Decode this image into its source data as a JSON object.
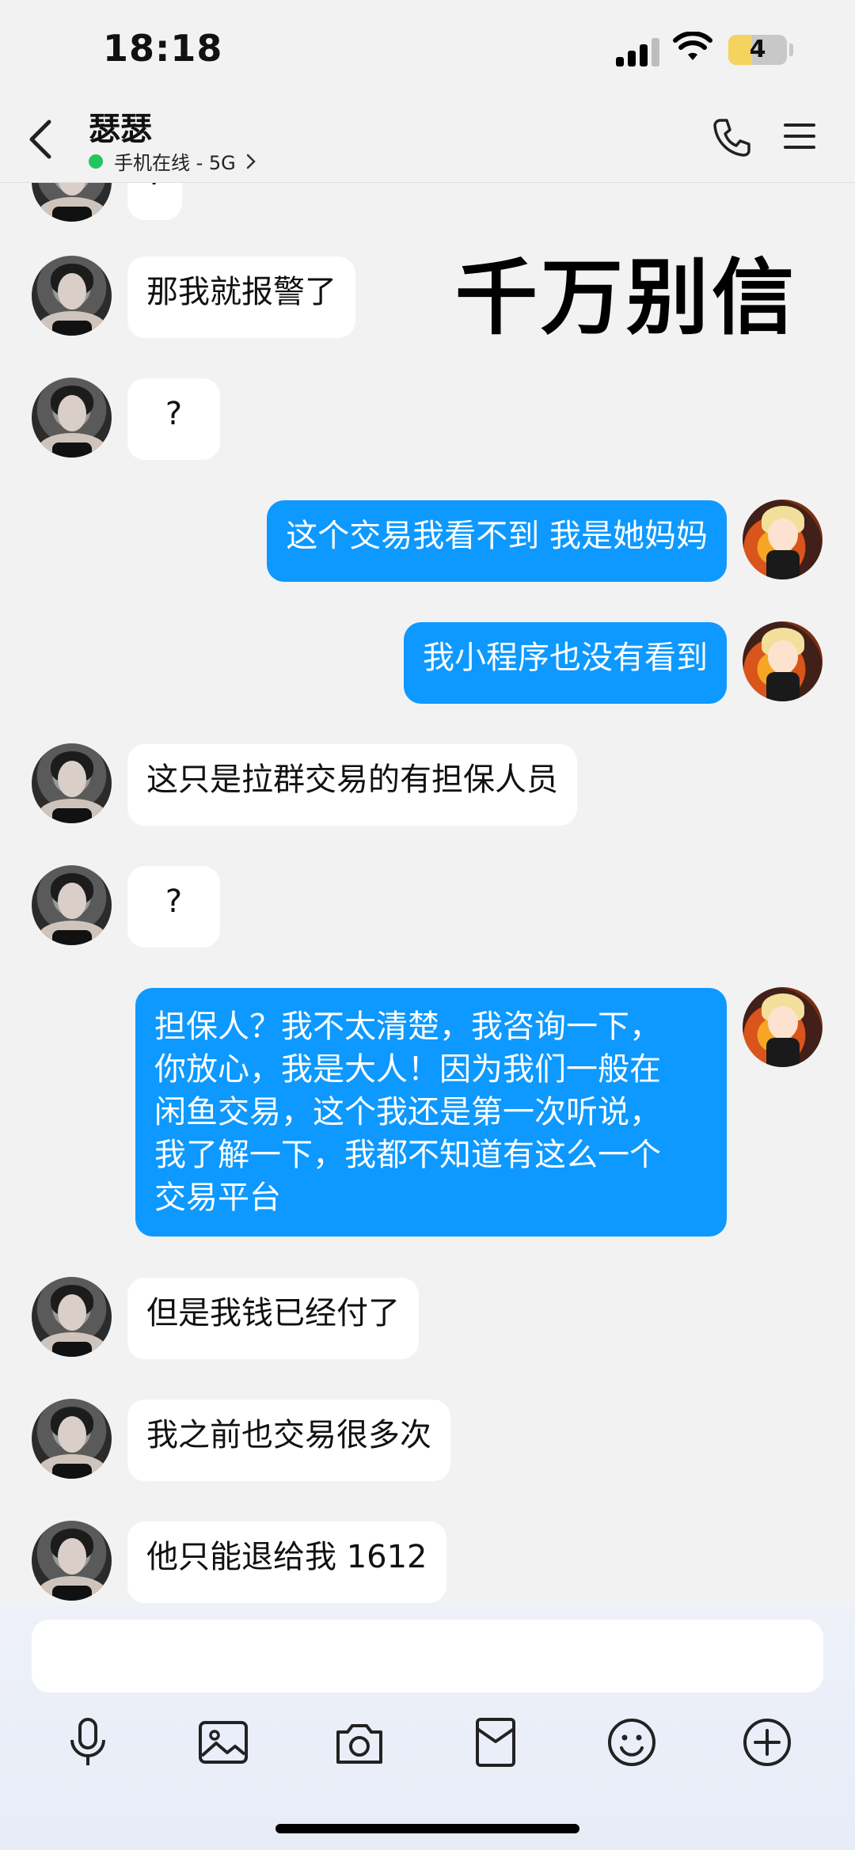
{
  "status_bar": {
    "time": "18:18",
    "battery": "4",
    "battery_level": 0.4
  },
  "header": {
    "contact_name": "瑟瑟",
    "online_status": "手机在线 - 5G"
  },
  "overlay_text": "千万别信",
  "messages": [
    {
      "from": "other",
      "text": "?"
    },
    {
      "from": "other",
      "text": "那我就报警了"
    },
    {
      "from": "other",
      "text": "?"
    },
    {
      "from": "me",
      "text": "这个交易我看不到 我是她妈妈"
    },
    {
      "from": "me",
      "text": "我小程序也没有看到"
    },
    {
      "from": "other",
      "text": "这只是拉群交易的有担保人员"
    },
    {
      "from": "other",
      "text": "?"
    },
    {
      "from": "me",
      "lines": [
        "担保人？我不太清楚，我咨询一下，",
        "你放心，我是大人！因为我们一般在",
        "闲鱼交易，这个我还是第一次听说，",
        "我了解一下，我都不知道有这么一个",
        "交易平台"
      ]
    },
    {
      "from": "other",
      "text": "但是我钱已经付了"
    },
    {
      "from": "other",
      "text": "我之前也交易很多次"
    },
    {
      "from": "other",
      "text": "他只能退给我 1612"
    }
  ],
  "input": {
    "placeholder": ""
  },
  "toolbar": [
    "microphone-icon",
    "image-icon",
    "camera-icon",
    "red-packet-icon",
    "emoji-icon",
    "plus-icon"
  ]
}
